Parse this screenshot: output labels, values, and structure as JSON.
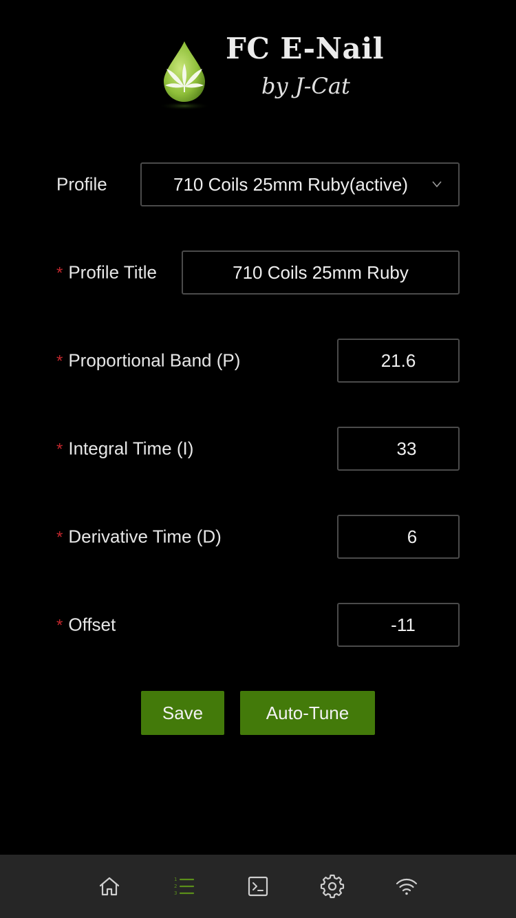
{
  "header": {
    "title": "FC E-Nail",
    "subtitle": "by J-Cat",
    "logo_icon": "cannabis-leaf-drop-icon",
    "logo_color": "#8fbf3a"
  },
  "form": {
    "profile": {
      "label": "Profile",
      "selected": "710 Coils 25mm Ruby(active)"
    },
    "profile_title": {
      "label": "Profile Title",
      "value": "710 Coils 25mm Ruby"
    },
    "proportional_band": {
      "label": "Proportional Band (P)",
      "value": "21.6"
    },
    "integral_time": {
      "label": "Integral Time (I)",
      "value": "33"
    },
    "derivative_time": {
      "label": "Derivative Time (D)",
      "value": "6"
    },
    "offset": {
      "label": "Offset",
      "value": "-11"
    },
    "required_marker": "*"
  },
  "buttons": {
    "save_label": "Save",
    "autotune_label": "Auto-Tune",
    "color": "#437a0a"
  },
  "tabbar": {
    "items": [
      {
        "icon": "home-icon",
        "active": false
      },
      {
        "icon": "numbered-list-icon",
        "active": true
      },
      {
        "icon": "terminal-icon",
        "active": false
      },
      {
        "icon": "gear-icon",
        "active": false
      },
      {
        "icon": "wifi-icon",
        "active": false
      }
    ],
    "active_color": "#5b8f1a",
    "inactive_color": "#cfcfcf"
  }
}
